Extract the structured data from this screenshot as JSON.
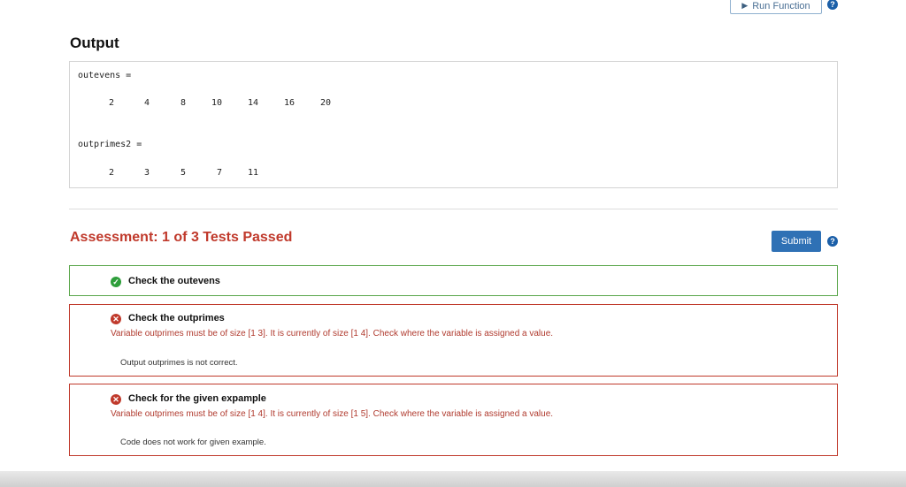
{
  "toolbar": {
    "run_label": "Run Function",
    "help_icon": "?"
  },
  "output": {
    "title": "Output",
    "blocks": [
      {
        "var_label": "outevens =",
        "values": [
          "2",
          "4",
          "8",
          "10",
          "14",
          "16",
          "20"
        ]
      },
      {
        "var_label": "outprimes2 =",
        "values": [
          "2",
          "3",
          "5",
          "7",
          "11"
        ]
      }
    ]
  },
  "assessment": {
    "title": "Assessment: 1 of 3 Tests Passed",
    "submit_label": "Submit",
    "help_icon": "?",
    "tests": [
      {
        "status": "pass",
        "icon": "✓",
        "name": "Check the outevens"
      },
      {
        "status": "fail",
        "icon": "✕",
        "name": "Check the outprimes",
        "message": "Variable outprimes must be of size [1 3]. It is currently of size [1 4]. Check where the variable is assigned a value.",
        "detail": "Output outprimes is not correct."
      },
      {
        "status": "fail",
        "icon": "✕",
        "name": "Check for the given expample",
        "message": "Variable outprimes must be of size [1 4]. It is currently of size [1 5]. Check where the variable is assigned a value.",
        "detail": "Code does not work for given example."
      }
    ]
  },
  "colors": {
    "pass": "#2e9e3b",
    "fail": "#c0392b",
    "accent": "#2f71b5"
  }
}
